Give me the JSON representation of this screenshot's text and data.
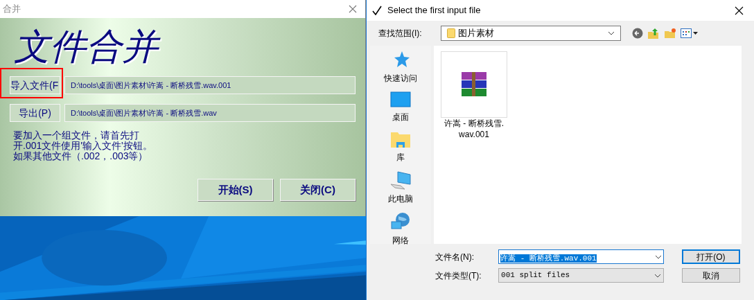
{
  "merge_window": {
    "title": "合并",
    "heading": "文件合并",
    "input_button": {
      "label": "导入文件(F",
      "highlighted": true
    },
    "input_path": "D:\\tools\\桌面\\图片素材\\许嵩 - 断桥残雪.wav.001",
    "output_button": "导出(P)",
    "output_path": "D:\\tools\\桌面\\图片素材\\许嵩 - 断桥残雪.wav",
    "help_lines": [
      "要加入一个组文件，请首先打",
      "开.001文件使用'输入文件'按钮。",
      "如果其他文件（.002，.003等）"
    ],
    "buttons": [
      "开始(S)",
      "关闭(C)"
    ]
  },
  "dialog": {
    "title": "Select the first input file",
    "look_in_label": "查找范围(I):",
    "look_in_value": "图片素材",
    "places": [
      {
        "kind": "star",
        "label": "快速访问"
      },
      {
        "kind": "desktop",
        "label": "桌面"
      },
      {
        "kind": "library",
        "label": "库"
      },
      {
        "kind": "computer",
        "label": "此电脑"
      },
      {
        "kind": "network",
        "label": "网络"
      }
    ],
    "files": [
      {
        "name_lines": [
          "许嵩 - 断桥残雪.",
          "wav.001"
        ]
      }
    ],
    "file_name_label": "文件名(N):",
    "file_name_value": "许嵩 - 断桥残雪.wav.001",
    "file_type_label": "文件类型(T):",
    "file_type_value": "001 split files",
    "open_button": "打开(O)",
    "cancel_button": "取消"
  }
}
